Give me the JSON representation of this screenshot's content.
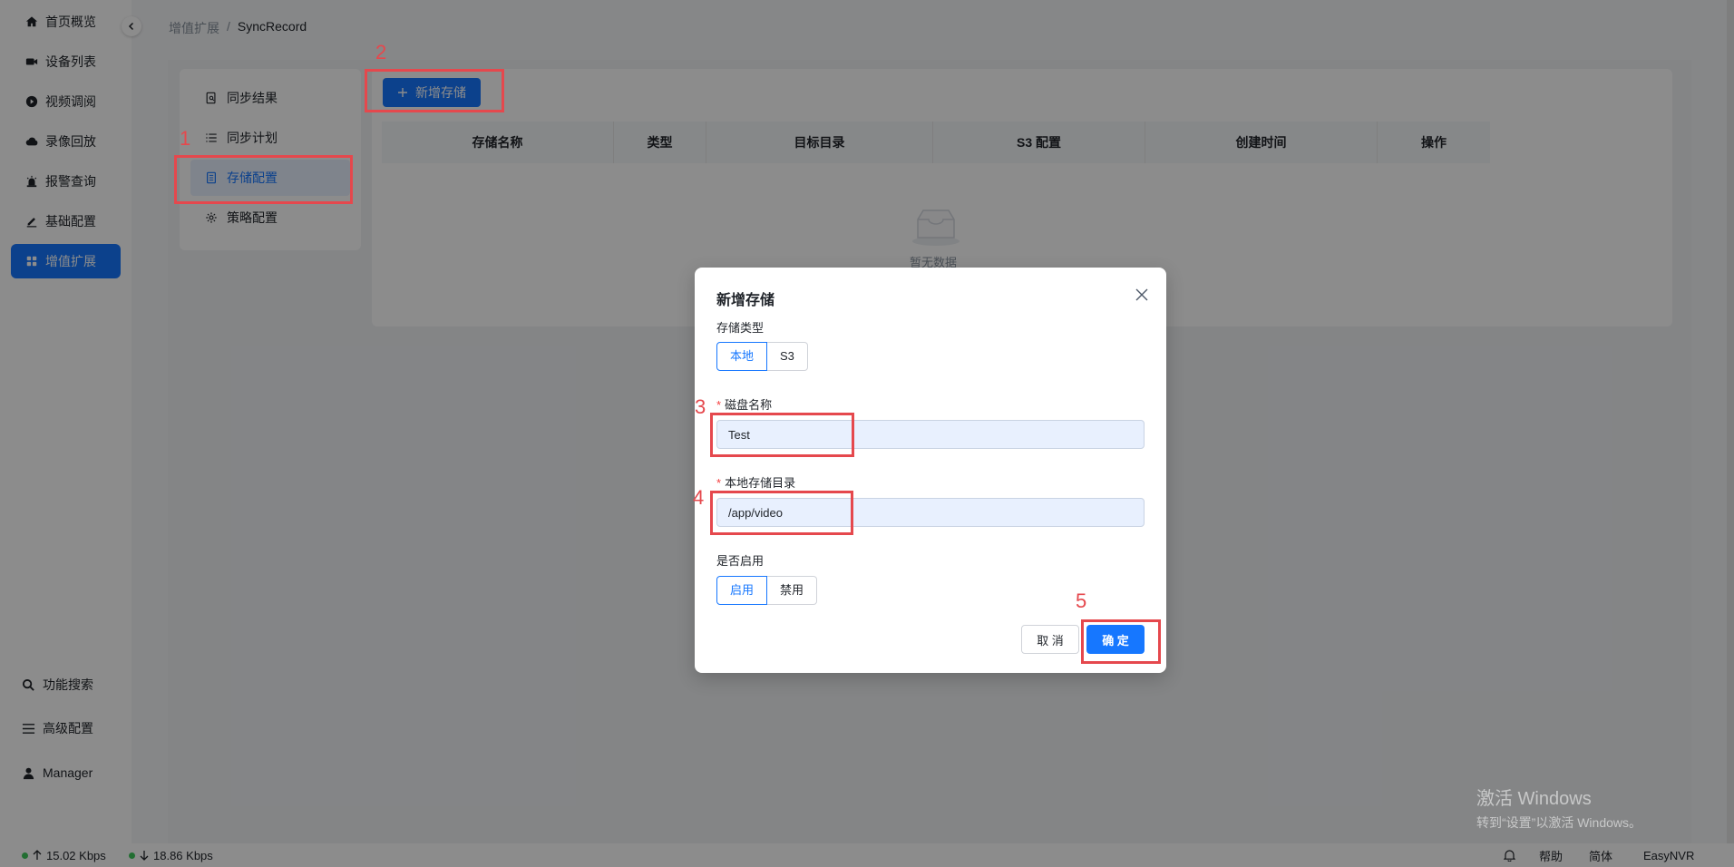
{
  "sidebar": {
    "items": [
      {
        "label": "首页概览",
        "icon": "home-icon"
      },
      {
        "label": "设备列表",
        "icon": "camera-icon"
      },
      {
        "label": "视频调阅",
        "icon": "play-circle-icon"
      },
      {
        "label": "录像回放",
        "icon": "cloud-icon"
      },
      {
        "label": "报警查询",
        "icon": "alarm-icon"
      },
      {
        "label": "基础配置",
        "icon": "edit-icon"
      },
      {
        "label": "增值扩展",
        "icon": "grid-icon",
        "active": true
      }
    ],
    "bottom": {
      "search": "功能搜索",
      "advanced": "高级配置",
      "user": "Manager"
    }
  },
  "breadcrumb": {
    "parent": "增值扩展",
    "separator": "/",
    "current": "SyncRecord"
  },
  "subnav": {
    "items": [
      {
        "label": "同步结果"
      },
      {
        "label": "同步计划"
      },
      {
        "label": "存储配置",
        "active": true
      },
      {
        "label": "策略配置"
      }
    ]
  },
  "toolbar": {
    "add_label": "新增存储"
  },
  "table": {
    "columns": [
      "存储名称",
      "类型",
      "目标目录",
      "S3 配置",
      "创建时间",
      "操作"
    ],
    "empty_text": "暂无数据"
  },
  "modal": {
    "title": "新增存储",
    "storage_type_label": "存储类型",
    "storage_type_options": [
      "本地",
      "S3"
    ],
    "storage_type_selected": "本地",
    "disk_name_label": "磁盘名称",
    "disk_name_value": "Test",
    "local_dir_label": "本地存储目录",
    "local_dir_value": "/app/video",
    "enable_label": "是否启用",
    "enable_options": [
      "启用",
      "禁用"
    ],
    "enable_selected": "启用",
    "cancel_label": "取 消",
    "ok_label": "确 定"
  },
  "annotations": [
    "1",
    "2",
    "3",
    "4",
    "5"
  ],
  "footer": {
    "upload": "15.02 Kbps",
    "download": "18.86 Kbps",
    "help": "帮助",
    "language": "简体",
    "brand": "EasyNVR"
  },
  "watermark": {
    "line1": "激活 Windows",
    "line2": "转到“设置”以激活 Windows。"
  },
  "colors": {
    "primary": "#1677ff",
    "annotation": "#e5484d",
    "status_dot": "#3fc95b"
  }
}
